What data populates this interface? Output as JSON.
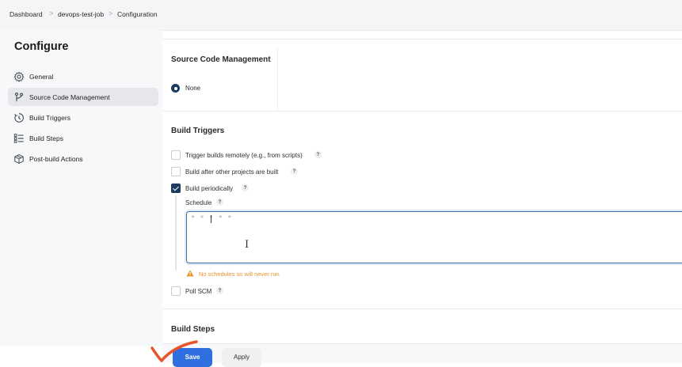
{
  "breadcrumb": {
    "items": [
      "Dashboard",
      "devops-test-job",
      "Configuration"
    ],
    "separator": ">"
  },
  "sidebar": {
    "title": "Configure",
    "items": [
      {
        "label": "General",
        "icon": "gear-icon"
      },
      {
        "label": "Source Code Management",
        "icon": "branch-icon",
        "active": true
      },
      {
        "label": "Build Triggers",
        "icon": "clock-icon"
      },
      {
        "label": "Build Steps",
        "icon": "list-icon"
      },
      {
        "label": "Post-build Actions",
        "icon": "package-icon"
      }
    ]
  },
  "scm": {
    "title": "Source Code Management",
    "options": [
      {
        "label": "None",
        "selected": true
      }
    ]
  },
  "triggers": {
    "title": "Build Triggers",
    "options": [
      {
        "label": "Trigger builds remotely (e.g., from scripts)",
        "checked": false
      },
      {
        "label": "Build after other projects are built",
        "checked": false
      },
      {
        "label": "Build periodically",
        "checked": true
      },
      {
        "label": "Poll SCM",
        "checked": false
      }
    ],
    "help_glyph": "?",
    "schedule": {
      "label": "Schedule",
      "value": "* * * * *",
      "warning": "No schedules so will never run"
    }
  },
  "build_steps": {
    "title": "Build Steps"
  },
  "footer": {
    "save_label": "Save",
    "apply_label": "Apply"
  },
  "colors": {
    "primary": "#2f6fe0",
    "checked": "#1d3b5f",
    "warning": "#e8942b",
    "annotation": "#e8542b",
    "focus_border": "#3f6ea8"
  }
}
